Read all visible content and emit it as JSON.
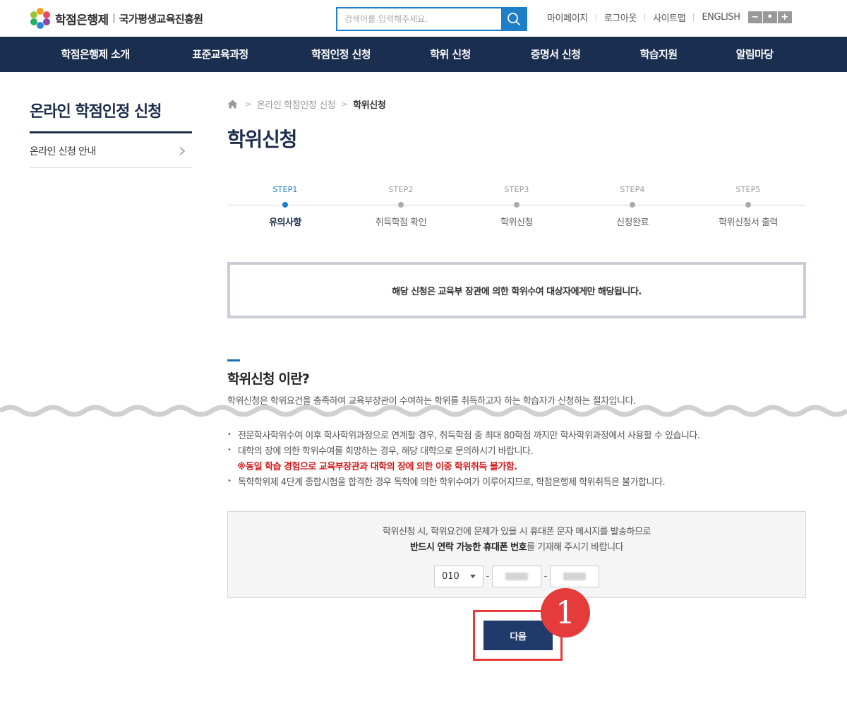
{
  "header": {
    "logo_title": "학점은행제",
    "logo_org": "국가평생교육진흥원",
    "search_placeholder": "검색어를 입력해주세요.",
    "util_links": [
      "마이페이지",
      "로그아웃",
      "사이트맵",
      "ENGLISH"
    ],
    "zoom": {
      "minus": "−",
      "reset": "•",
      "plus": "+"
    }
  },
  "nav": {
    "items": [
      "학점은행제 소개",
      "표준교육과정",
      "학점인정 신청",
      "학위 신청",
      "증명서 신청",
      "학습지원",
      "알림마당"
    ]
  },
  "sidebar": {
    "title": "온라인 학점인정 신청",
    "items": [
      {
        "label": "온라인 신청 안내"
      }
    ]
  },
  "breadcrumb": {
    "items": [
      "온라인 학점인정 신청"
    ],
    "current": "학위신청"
  },
  "page_title": "학위신청",
  "steps": [
    {
      "num": "STEP1",
      "label": "유의사항",
      "active": true
    },
    {
      "num": "STEP2",
      "label": "취득학점 확인",
      "active": false
    },
    {
      "num": "STEP3",
      "label": "학위신청",
      "active": false
    },
    {
      "num": "STEP4",
      "label": "신청완료",
      "active": false
    },
    {
      "num": "STEP5",
      "label": "학위신청서 출력",
      "active": false
    }
  ],
  "notice": "해당 신청은 교육부 장관에 의한 학위수여 대상자에게만 해당됩니다.",
  "section": {
    "title": "학위신청 이란?",
    "desc": "학위신청은 학위요건을 충족하여 교육부장관이 수여하는 학위를 취득하고자 하는 학습자가 신청하는 절차입니다.",
    "bullets": [
      {
        "text": "전문학사학위수여 이후 학사학위과정으로 연계할 경우, 취득학점 중 최대 80학점 까지만 학사학위과정에서 사용할 수 있습니다.",
        "warn": false
      },
      {
        "text": "대학의 장에 의한 학위수여를 희망하는 경우, 해당 대학으로 문의하시기 바랍니다.",
        "warn": false
      },
      {
        "text": "※동일 학습 경험으로 교육부장관과 대학의 장에 의한 이중 학위취득 불가함.",
        "warn": true
      },
      {
        "text": "독학학위제 4단계 종합시험을 합격한 경우 독학에 의한 학위수여가 이루어지므로, 학점은행제 학위취득은 불가합니다.",
        "warn": false
      }
    ]
  },
  "phone": {
    "line1": "학위신청 시, 학위요건에 문제가 있을 시 휴대폰 문자 메시지를 발송하므로",
    "line2_bold": "반드시 연락 가능한 휴대폰 번호",
    "line2_rest": "를 기재해 주시기 바랍니다",
    "prefix": "010",
    "dash": "-"
  },
  "next_label": "다음",
  "badge_number": "1",
  "colors": {
    "nav_bg": "#1a2e50",
    "accent": "#1e7ec8",
    "button": "#1f3a6b",
    "highlight": "#e53b3b",
    "warning_text": "#d21a1a"
  }
}
